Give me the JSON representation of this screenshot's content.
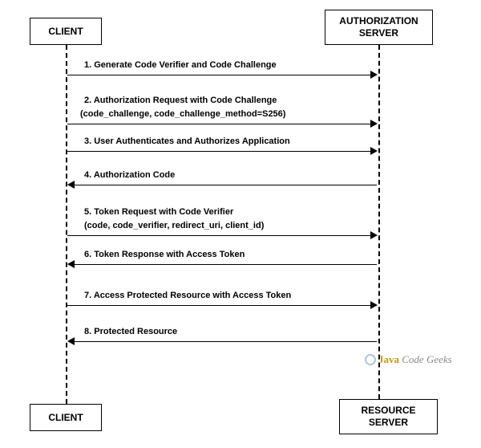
{
  "participants": {
    "client_top": "CLIENT",
    "auth_server_top": "AUTHORIZATION\nSERVER",
    "client_bottom": "CLIENT",
    "resource_server_bottom": "RESOURCE\nSERVER"
  },
  "messages": {
    "m1": "1. Generate Code Verifier and Code Challenge",
    "m2": "2. Authorization Request with Code Challenge",
    "m2sub": "(code_challenge, code_challenge_method=S256)",
    "m3": "3. User Authenticates and Authorizes Application",
    "m4": "4. Authorization Code",
    "m5": "5. Token Request with Code Verifier",
    "m5sub": " (code, code_verifier, redirect_uri, client_id)",
    "m6": "6. Token Response with Access Token",
    "m7": "7. Access Protected Resource with Access Token",
    "m8": "8. Protected Resource"
  },
  "watermark": {
    "brand1": "Java",
    "brand2": "Code",
    "brand3": "Geeks"
  }
}
